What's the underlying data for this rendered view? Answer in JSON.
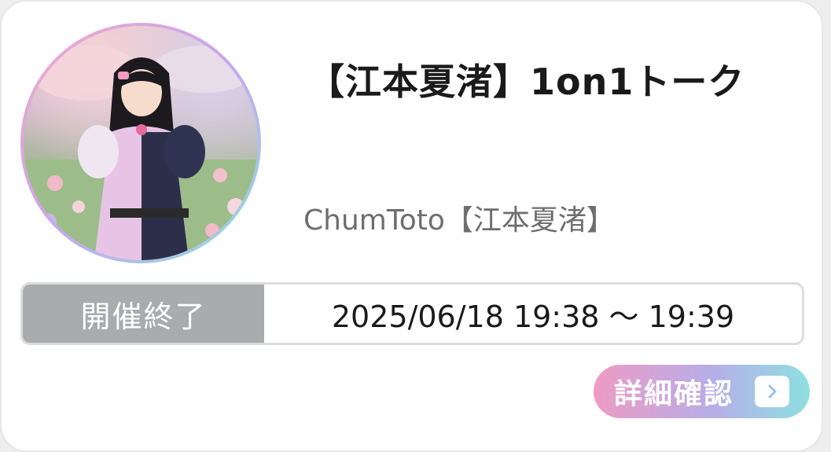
{
  "card": {
    "title": "【江本夏渚】1on1トーク",
    "subtitle": "ChumToto【江本夏渚】",
    "status": "開催終了",
    "datetime": "2025/06/18 19:38 ～ 19:39",
    "detail_button_label": "詳細確認",
    "detail_icon": "chevron-right-icon",
    "avatar": "avatar-photo"
  },
  "colors": {
    "status_badge_bg": "#a9abad",
    "button_gradient_start": "#ee9bc4",
    "button_gradient_mid": "#b6aee8",
    "button_gradient_end": "#8ee0e0"
  }
}
